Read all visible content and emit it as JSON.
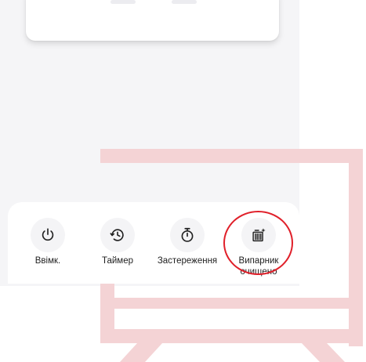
{
  "actions": [
    {
      "label": "Ввімк.",
      "icon": "power-icon"
    },
    {
      "label": "Таймер",
      "icon": "timer-history-icon"
    },
    {
      "label": "Застереження",
      "icon": "stopwatch-icon"
    },
    {
      "label": "Випарник\nочищено",
      "icon": "evaporator-clean-icon"
    }
  ],
  "colors": {
    "highlight": "#e0202a",
    "watermark": "#f4d3d5"
  }
}
